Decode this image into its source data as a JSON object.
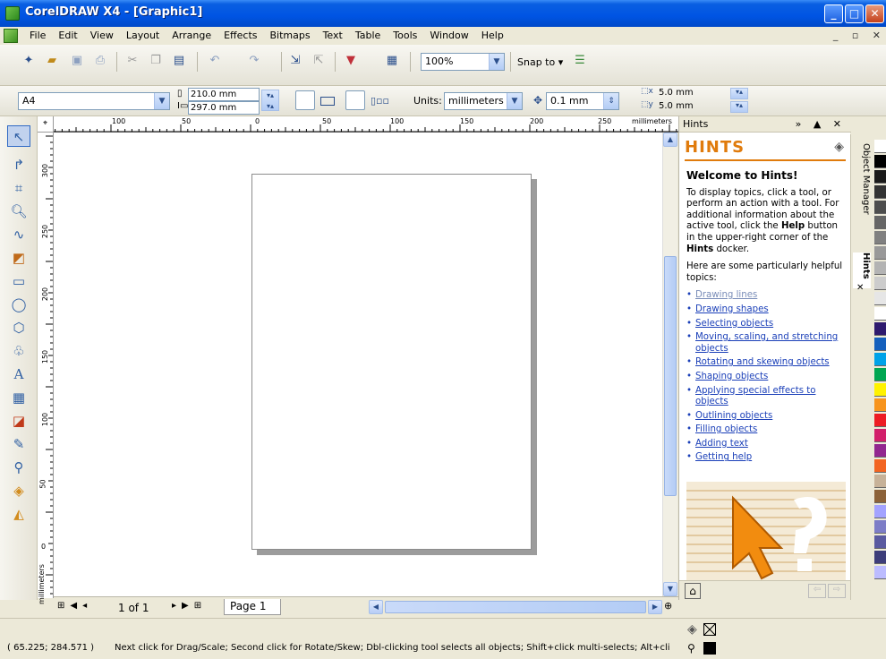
{
  "window": {
    "title": "CorelDRAW X4 - [Graphic1]",
    "minimize": "_",
    "maximize": "□",
    "close": "✕"
  },
  "menu": [
    "File",
    "Edit",
    "View",
    "Layout",
    "Arrange",
    "Effects",
    "Bitmaps",
    "Text",
    "Table",
    "Tools",
    "Window",
    "Help"
  ],
  "mdi_controls": "_ ▫ ✕",
  "toolbar": {
    "zoom": "100%",
    "snap_to": "Snap to"
  },
  "propbar": {
    "paper_size": "A4",
    "width": "210.0 mm",
    "height": "297.0 mm",
    "units_label": "Units:",
    "units": "millimeters",
    "nudge": "0.1 mm",
    "dup_x": "5.0 mm",
    "dup_y": "5.0 mm"
  },
  "rulers": {
    "h_ticks": [
      "100",
      "50",
      "0",
      "50",
      "100",
      "150",
      "200",
      "250"
    ],
    "h_unit": "millimeters",
    "v_ticks": [
      "300",
      "250",
      "200",
      "150",
      "100",
      "50",
      "0"
    ],
    "v_unit": "millimeters"
  },
  "pagenav": {
    "count": "1 of 1",
    "tab": "Page 1"
  },
  "docker": {
    "header": "Hints",
    "banner": "HINTS",
    "heading": "Welcome to Hints!",
    "para1_a": "To display topics, click a tool, or perform an action with a tool. For additional information about the active tool, click the ",
    "para1_help": "Help",
    "para1_b": " button in the upper-right corner of the ",
    "para1_hints": "Hints",
    "para1_c": " docker.",
    "para2": "Here are some particularly helpful topics:",
    "topics": [
      "Drawing lines",
      "Drawing shapes",
      "Selecting objects",
      "Moving, scaling, and stretching objects",
      "Rotating and skewing objects",
      "Shaping objects",
      "Applying special effects to objects",
      "Outlining objects",
      "Filling objects",
      "Adding text",
      "Getting help"
    ],
    "tabs": [
      "Object Manager",
      "Hints"
    ]
  },
  "status": {
    "coords": "( 65.225; 284.571 )",
    "message": "Next click for Drag/Scale; Second click for Rotate/Skew; Dbl-clicking tool selects all objects; Shift+click multi-selects; Alt+clic..."
  },
  "palette": [
    "#ffffff",
    "#000000",
    "#1a1a1a",
    "#333333",
    "#4d4d4d",
    "#666666",
    "#808080",
    "#999999",
    "#b3b3b3",
    "#cccccc",
    "#e6e6e6",
    "#ffffff",
    "#2e1a6e",
    "#1560bd",
    "#00a2e8",
    "#00a651",
    "#fff200",
    "#f7941d",
    "#ed1c24",
    "#d21f6b",
    "#92278f",
    "#f26522",
    "#c7b299",
    "#8c6239",
    "#a3a3ff",
    "#7d7dc7",
    "#5a5aa0",
    "#3d3d7a",
    "#bcbcff"
  ],
  "accent_orange": "#e07b0c",
  "link_color": "#1a3fb8"
}
